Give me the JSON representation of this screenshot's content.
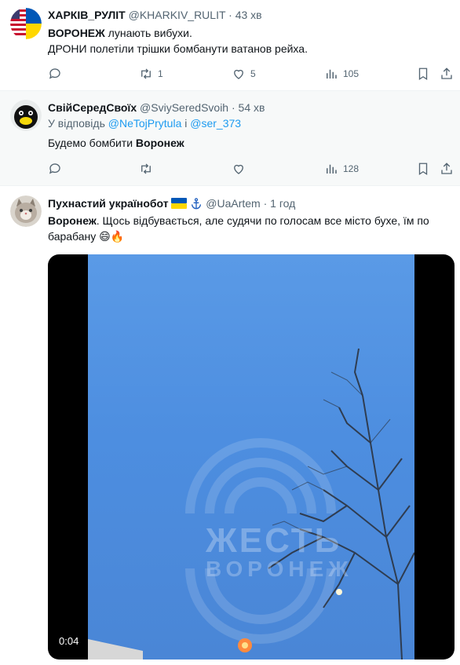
{
  "tweets": [
    {
      "name": "ХАРКІВ_РУЛІТ",
      "handle": "@KHARKIV_RULIT",
      "separator": "·",
      "time": "43 хв",
      "line1_bold": "ВОРОНЕЖ",
      "line1_rest": " лунають вибухи.",
      "line2": "ДРОНИ полетіли трішки бомбанути ватанов рейха.",
      "replies": "",
      "retweets": "1",
      "likes": "5",
      "views": "105"
    },
    {
      "name": "СвійСередСвоїх",
      "handle": "@SviySeredSvoih",
      "separator": "·",
      "time": "54 хв",
      "reply_prefix": "У відповідь ",
      "reply_user1": "@NeTojPrytula",
      "reply_and": " і ",
      "reply_user2": "@ser_373",
      "text_plain": "Будемо бомбити ",
      "text_bold": "Воронеж",
      "views": "128"
    },
    {
      "name": "Пухнастий українобот",
      "handle": "@UaArtem",
      "separator": "·",
      "time": "1 год",
      "text_bold": "Воронеж",
      "text_line1": ". Щось відбувається, але судячи по голосам все місто бухе, їм по",
      "text_line2": "барабану",
      "emoji": "😄🔥",
      "video_time": "0:04",
      "watermark_line1": "ЖЕСТЬ",
      "watermark_line2": "ВОРОНЕЖ"
    }
  ],
  "colors": {
    "text_primary": "#0f1419",
    "text_secondary": "#536471",
    "link": "#1d9bf0",
    "verified_flag_blue": "#0057b7",
    "verified_flag_yellow": "#ffd700"
  },
  "icons": [
    "reply-icon",
    "retweet-icon",
    "like-icon",
    "views-icon",
    "bookmark-icon",
    "share-icon",
    "ukraine-flag-icon",
    "anchor-icon"
  ]
}
